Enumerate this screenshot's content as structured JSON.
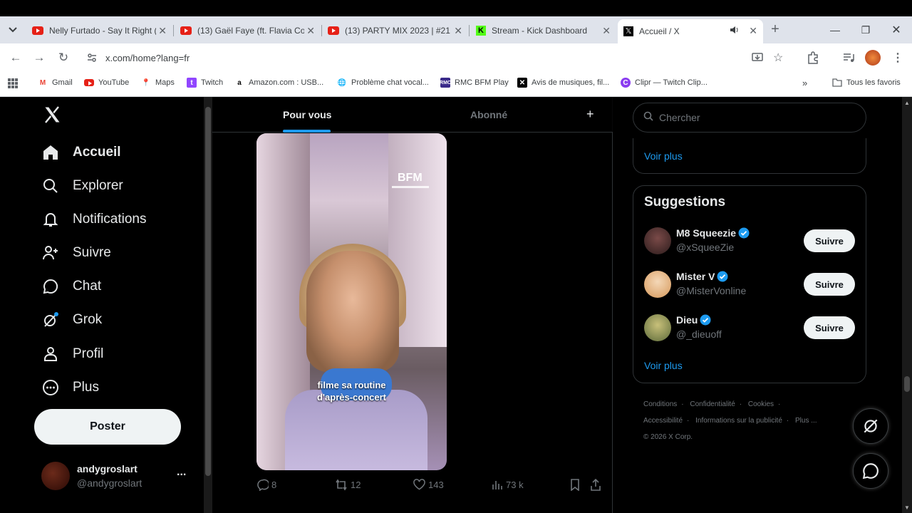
{
  "browser": {
    "tabs": [
      {
        "title": "Nelly Furtado - Say It Right (",
        "favicon": "youtube-icon"
      },
      {
        "title": "(13) Gaël Faye (ft. Flavia Coe",
        "favicon": "youtube-icon"
      },
      {
        "title": "(13) PARTY MIX 2023 | #21 |",
        "favicon": "youtube-icon"
      },
      {
        "title": "Stream - Kick Dashboard",
        "favicon": "kick-icon"
      },
      {
        "title": "Accueil / X",
        "favicon": "x-icon",
        "active": true
      }
    ],
    "url": "x.com/home?lang=fr",
    "bookmarks": [
      {
        "label": "Gmail"
      },
      {
        "label": "YouTube"
      },
      {
        "label": "Maps"
      },
      {
        "label": "Twitch"
      },
      {
        "label": "Amazon.com : USB..."
      },
      {
        "label": "Problème chat vocal..."
      },
      {
        "label": "RMC BFM Play"
      },
      {
        "label": "Avis de musiques, fil..."
      },
      {
        "label": "Clipr — Twitch Clip..."
      }
    ],
    "all_bookmarks": "Tous les favoris",
    "colors": {
      "tabstrip": "#dfe3eb",
      "active_tab": "#ffffff"
    }
  },
  "x": {
    "logo": "X",
    "nav": [
      {
        "label": "Accueil",
        "icon": "home-icon"
      },
      {
        "label": "Explorer",
        "icon": "search-icon"
      },
      {
        "label": "Notifications",
        "icon": "bell-icon"
      },
      {
        "label": "Suivre",
        "icon": "person-add-icon"
      },
      {
        "label": "Chat",
        "icon": "chat-icon"
      },
      {
        "label": "Grok",
        "icon": "grok-icon"
      },
      {
        "label": "Profil",
        "icon": "profile-icon"
      },
      {
        "label": "Plus",
        "icon": "more-circle-icon"
      }
    ],
    "post_button": "Poster",
    "account": {
      "name": "andygroslart",
      "handle": "@andygroslart",
      "more": "..."
    },
    "feed_tabs": {
      "for_you": "Pour vous",
      "following": "Abonné",
      "add": "+"
    },
    "post": {
      "watermark": "BFM",
      "caption_line1": "filme sa routine",
      "caption_line2": "d'après-concert",
      "replies": "8",
      "reposts": "12",
      "likes": "143",
      "views": "73 k"
    },
    "search": {
      "placeholder": "Chercher"
    },
    "trends_more": "Voir plus",
    "suggestions": {
      "title": "Suggestions",
      "items": [
        {
          "name": "M8 Squeezie",
          "handle": "@xSqueeZie",
          "button": "Suivre"
        },
        {
          "name": "Mister V",
          "handle": "@MisterVonline",
          "button": "Suivre"
        },
        {
          "name": "Dieu",
          "handle": "@_dieuoff",
          "button": "Suivre"
        }
      ],
      "more": "Voir plus"
    },
    "footer": {
      "links": [
        "Conditions",
        "Confidentialité",
        "Cookies",
        "Accessibilité",
        "Informations sur la publicité",
        "Plus ..."
      ],
      "copyright": "© 2026 X Corp."
    },
    "colors": {
      "accent": "#1d9bf0",
      "text": "#e7e9ea",
      "muted": "#71767b",
      "border": "#2f3336"
    }
  }
}
